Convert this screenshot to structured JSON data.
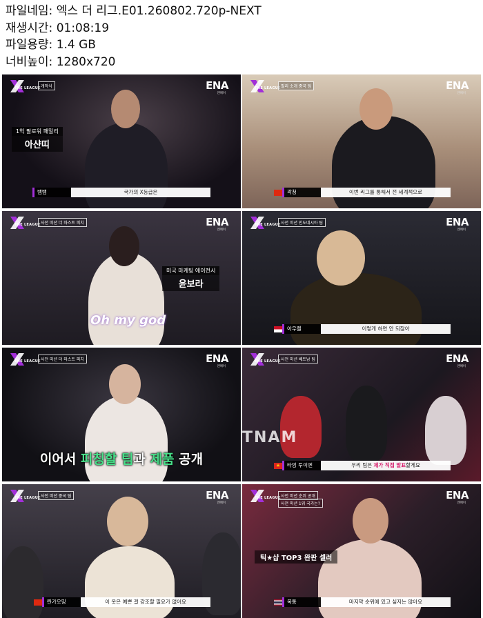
{
  "info": {
    "filename": "파일네임: 엑스 더 리그.E01.260802.720p-NEXT",
    "runtime": "재생시간: 01:08:19",
    "filesize": "파일용량: 1.4 GB",
    "resolution": "너비높이: 1280x720"
  },
  "branding": {
    "show_logo": "THE LEAGUE",
    "channel": "ENA",
    "channel_sub": "엔에이"
  },
  "thumbs": [
    {
      "segment": "개막식",
      "name_card": {
        "top": "1억 팔로워 패밀리",
        "name": "아샨띠"
      },
      "subtitle": {
        "speaker": "뱀뱀",
        "text": "국가의 X등급은"
      },
      "flag": "x-icon",
      "colors": {
        "bg": "#121018",
        "accent": "#a22fd8"
      }
    },
    {
      "segment": "필리 소개 중국 팀",
      "subtitle": {
        "speaker": "곽청",
        "text": "이번 리그를 통해서 전 세계적으로"
      },
      "flag": "china-flag-icon",
      "colors": {
        "bg": "#b8a898"
      }
    },
    {
      "segment": "사전 미션 더 마스트 피치",
      "name_card": {
        "top": "미국 마케팅 에이전시",
        "name": "윤보라"
      },
      "script_text": "Oh my god",
      "colors": {
        "bg": "#2a2630"
      }
    },
    {
      "segment": "사전 미션 인도네시아 팀",
      "subtitle": {
        "speaker": "아우렐",
        "text": "이렇게 하면 안 되잖아"
      },
      "flag": "indonesia-flag-icon",
      "colors": {
        "bg": "#1b1b22"
      }
    },
    {
      "segment": "사전 미션 더 마스트 피치",
      "caption_parts": [
        "이어서 ",
        "피칭할 팀",
        "과 ",
        "제품",
        " 공개"
      ],
      "colors": {
        "bg": "#16141a"
      }
    },
    {
      "segment": "사전 미션 베트남 팀",
      "stage_text": "TNAM",
      "subtitle": {
        "speaker": "타잉 투이엔",
        "text_a": "우리 팀은 ",
        "text_b": "제가 직접 발표",
        "text_c": "할게요"
      },
      "flag": "vietnam-flag-icon",
      "colors": {
        "bg": "#24202a"
      }
    },
    {
      "segment": "사전 미션 중국 팀",
      "subtitle": {
        "speaker": "란가오밍",
        "text": "이 옷은 예쁜 걸 강조할 필요가 없어요"
      },
      "flag": "china-flag-icon",
      "colors": {
        "bg": "#2b2a33"
      }
    },
    {
      "segment": "사전 미션 순위 공개",
      "segment_sub": "사전 미션 1위 국가는?",
      "name_card": {
        "top": "",
        "name": "틱★샵 TOP3 완판 셀러"
      },
      "subtitle": {
        "speaker": "목통",
        "text": "마지막 순위에 있고 싶지는 않아요"
      },
      "flag": "thailand-flag-icon",
      "colors": {
        "bg": "#3a2430"
      }
    }
  ]
}
